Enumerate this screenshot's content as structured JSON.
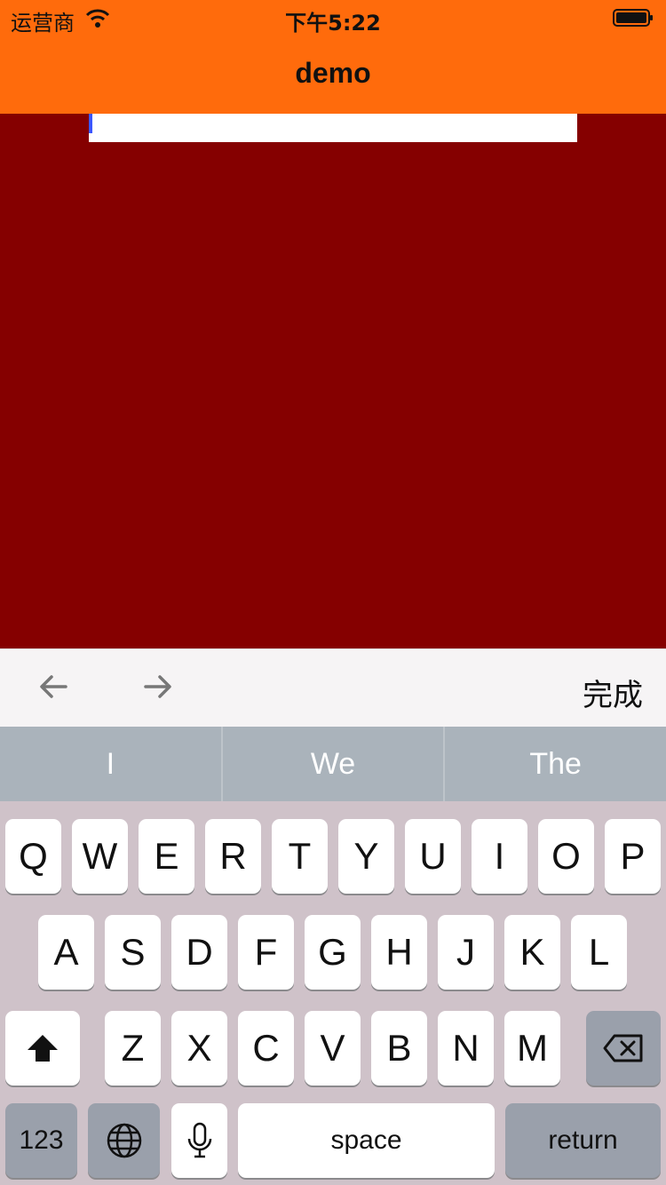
{
  "status_bar": {
    "carrier": "运营商",
    "time": "下午5:22"
  },
  "nav": {
    "title": "demo"
  },
  "text_field": {
    "value": "",
    "placeholder": ""
  },
  "accessory": {
    "done_label": "完成",
    "prev_icon": "arrow-left-icon",
    "next_icon": "arrow-right-icon"
  },
  "suggestions": [
    "I",
    "We",
    "The"
  ],
  "keyboard": {
    "row1": [
      "Q",
      "W",
      "E",
      "R",
      "T",
      "Y",
      "U",
      "I",
      "O",
      "P"
    ],
    "row2": [
      "A",
      "S",
      "D",
      "F",
      "G",
      "H",
      "J",
      "K",
      "L"
    ],
    "row3": [
      "Z",
      "X",
      "C",
      "V",
      "B",
      "N",
      "M"
    ],
    "numbers_label": "123",
    "space_label": "space",
    "return_label": "return"
  },
  "colors": {
    "nav_background": "#ff6b0c",
    "content_background": "#850000",
    "keyboard_background": "#cfc2c9",
    "suggestion_background": "#aab3bb"
  }
}
